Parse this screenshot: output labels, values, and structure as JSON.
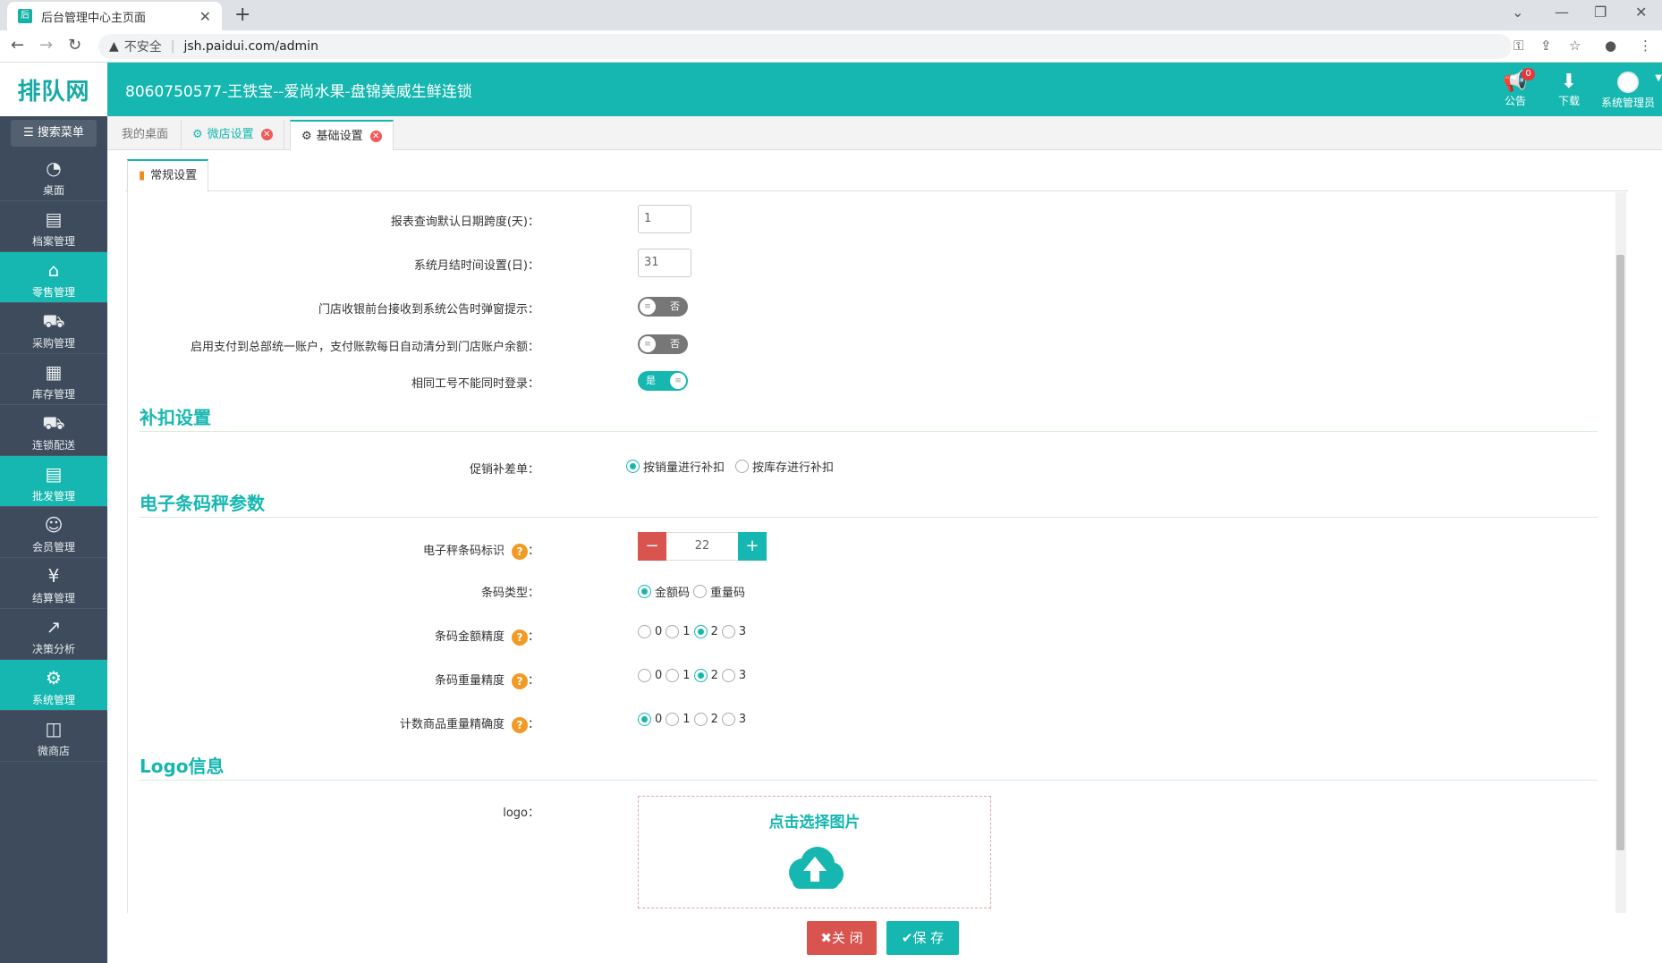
{
  "browser": {
    "tab_title": "后台管理中心主页面",
    "tab_favicon": "后",
    "security_label": "不安全",
    "url": "jsh.paidui.com/admin"
  },
  "header": {
    "logo_text": "排队网",
    "company": "8060750577-王铁宝--爱尚水果-盘锦美威生鲜连锁",
    "notice_label": "公告",
    "notice_count": "0",
    "download_label": "下载",
    "user_label": "系统管理员"
  },
  "sidebar": {
    "search_label": "搜索菜单",
    "items": [
      {
        "label": "桌面",
        "icon": "dashboard-icon"
      },
      {
        "label": "档案管理",
        "icon": "archive-icon"
      },
      {
        "label": "零售管理",
        "icon": "store-icon"
      },
      {
        "label": "采购管理",
        "icon": "cart-icon"
      },
      {
        "label": "库存管理",
        "icon": "inventory-icon"
      },
      {
        "label": "连锁配送",
        "icon": "truck-icon"
      },
      {
        "label": "批发管理",
        "icon": "wholesale-icon"
      },
      {
        "label": "会员管理",
        "icon": "member-icon"
      },
      {
        "label": "结算管理",
        "icon": "settlement-icon"
      },
      {
        "label": "决策分析",
        "icon": "chart-icon"
      },
      {
        "label": "系统管理",
        "icon": "gear-icon"
      },
      {
        "label": "微商店",
        "icon": "bag-icon"
      }
    ]
  },
  "page_tabs": [
    "我的桌面",
    "微店设置",
    "基础设置"
  ],
  "sub_tab": "常规设置",
  "form": {
    "report_days_label": "报表查询默认日期跨度(天)：",
    "report_days_value": "1",
    "month_end_label": "系统月结时间设置(日)：",
    "month_end_value": "31",
    "popup_notice_label": "门店收银前台接收到系统公告时弹窗提示：",
    "popup_notice_state": "否",
    "unified_pay_label": "启用支付到总部统一账户，支付账款每日自动清分到门店账户余额：",
    "unified_pay_state": "否",
    "same_login_label": "相同工号不能同时登录：",
    "same_login_state": "是",
    "section_supplement": "补扣设置",
    "promo_label": "促销补差单：",
    "promo_options": [
      "按销量进行补扣",
      "按库存进行补扣"
    ],
    "section_scale": "电子条码秤参数",
    "scale_flag_label": "电子秤条码标识",
    "scale_flag_value": "22",
    "barcode_type_label": "条码类型：",
    "barcode_type_options": [
      "金额码",
      "重量码"
    ],
    "amount_precision_label": "条码金额精度",
    "weight_precision_label": "条码重量精度",
    "count_precision_label": "计数商品重量精确度",
    "precision_options": [
      "0",
      "1",
      "2",
      "3"
    ],
    "colon": "：",
    "section_logo": "Logo信息",
    "logo_label": "logo：",
    "upload_text": "点击选择图片"
  },
  "buttons": {
    "close": "关 闭",
    "save": "保 存"
  }
}
